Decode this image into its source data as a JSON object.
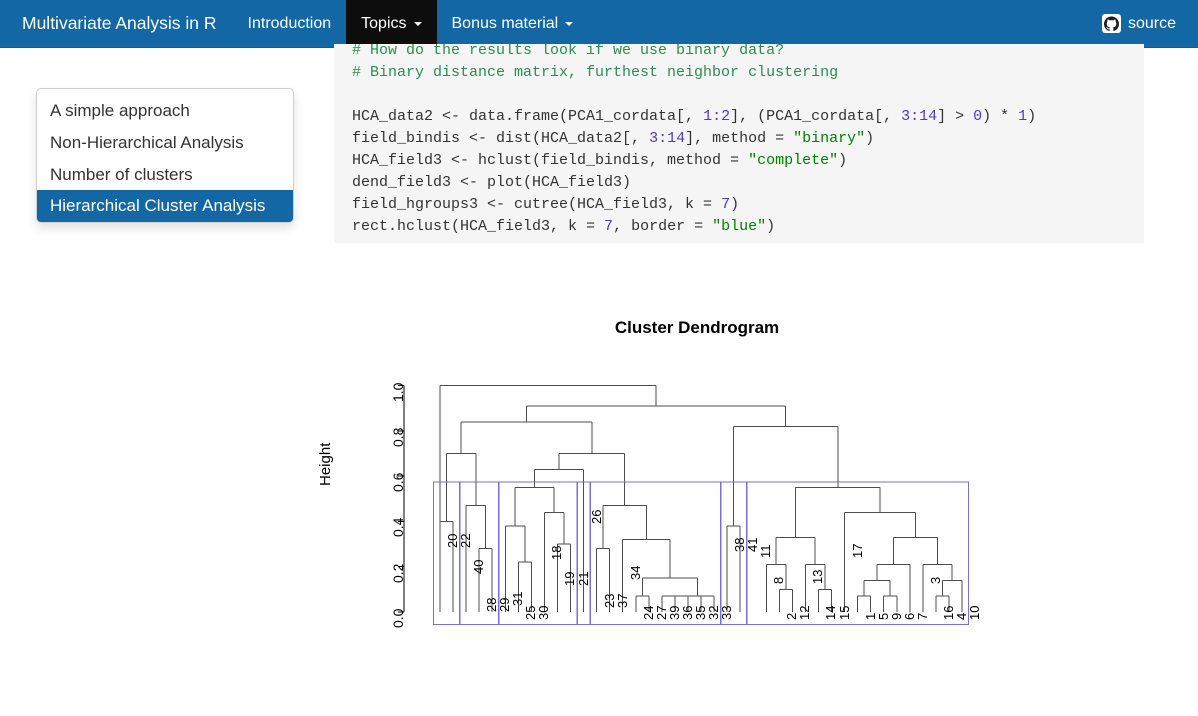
{
  "navbar": {
    "brand": "Multivariate Analysis in R",
    "items": [
      {
        "label": "Introduction",
        "active": false,
        "caret": false
      },
      {
        "label": "Topics",
        "active": true,
        "caret": true
      },
      {
        "label": "Bonus material",
        "active": false,
        "caret": true
      }
    ],
    "source_label": "source",
    "bg_color": "#1267a4",
    "active_bg_color": "#0d0d0d"
  },
  "sidebar": {
    "items": [
      {
        "label": "A simple approach",
        "selected": false
      },
      {
        "label": "Non-Hierarchical Analysis",
        "selected": false
      },
      {
        "label": "Number of clusters",
        "selected": false
      },
      {
        "label": "Hierarchical Cluster Analysis",
        "selected": true
      }
    ],
    "selected_bg_color": "#1267a4"
  },
  "code": {
    "lines": [
      [
        {
          "t": "# How do the results look if we use binary data?",
          "c": "com"
        }
      ],
      [
        {
          "t": "# Binary distance matrix, furthest neighbor clustering",
          "c": "com"
        }
      ],
      [
        {
          "t": "",
          "c": ""
        }
      ],
      [
        {
          "t": "HCA_data2 <- data.frame(PCA1_cordata[, ",
          "c": ""
        },
        {
          "t": "1:2",
          "c": "num"
        },
        {
          "t": "], (PCA1_cordata[, ",
          "c": ""
        },
        {
          "t": "3:14",
          "c": "num"
        },
        {
          "t": "] > ",
          "c": ""
        },
        {
          "t": "0",
          "c": "num"
        },
        {
          "t": ") * ",
          "c": ""
        },
        {
          "t": "1",
          "c": "num"
        },
        {
          "t": ")",
          "c": ""
        }
      ],
      [
        {
          "t": "field_bindis <- dist(HCA_data2[, ",
          "c": ""
        },
        {
          "t": "3:14",
          "c": "num"
        },
        {
          "t": "], method = ",
          "c": ""
        },
        {
          "t": "\"binary\"",
          "c": "str"
        },
        {
          "t": ")",
          "c": ""
        }
      ],
      [
        {
          "t": "HCA_field3 <- hclust(field_bindis, method = ",
          "c": ""
        },
        {
          "t": "\"complete\"",
          "c": "str"
        },
        {
          "t": ")",
          "c": ""
        }
      ],
      [
        {
          "t": "dend_field3 <- plot(HCA_field3)",
          "c": ""
        }
      ],
      [
        {
          "t": "field_hgroups3 <- cutree(HCA_field3, k = ",
          "c": ""
        },
        {
          "t": "7",
          "c": "num"
        },
        {
          "t": ")",
          "c": ""
        }
      ],
      [
        {
          "t": "rect.hclust(HCA_field3, k = ",
          "c": ""
        },
        {
          "t": "7",
          "c": "num"
        },
        {
          "t": ", border = ",
          "c": ""
        },
        {
          "t": "\"blue\"",
          "c": "str"
        },
        {
          "t": ")",
          "c": ""
        }
      ]
    ],
    "bg_color": "#f5f5f5"
  },
  "chart_data": {
    "type": "dendrogram",
    "title": "Cluster Dendrogram",
    "ylabel": "Height",
    "xlabel": "",
    "ylim": [
      0.0,
      1.06
    ],
    "yticks": [
      "0.0",
      "0.2",
      "0.4",
      "0.6",
      "0.8",
      "1.0"
    ],
    "ytick_values": [
      0.0,
      0.2,
      0.4,
      0.6,
      0.8,
      1.0
    ],
    "grid": false,
    "legend": "none",
    "cut_k": 7,
    "rect_border_color": "#7a6fd4",
    "link_color": "#4d4d4d",
    "leaf_labels": [
      "20",
      "22",
      "40",
      "28",
      "29",
      "31",
      "25",
      "30",
      "18",
      "19",
      "21",
      "26",
      "23",
      "37",
      "34",
      "24",
      "27",
      "39",
      "36",
      "35",
      "32",
      "33",
      "38",
      "41",
      "11",
      "8",
      "2",
      "12",
      "13",
      "14",
      "15",
      "17",
      "1",
      "5",
      "9",
      "6",
      "7",
      "3",
      "16",
      "4",
      "10"
    ],
    "clusters": [
      {
        "index": 1,
        "leaves": [
          "20",
          "22"
        ]
      },
      {
        "index": 2,
        "leaves": [
          "40",
          "28",
          "29"
        ]
      },
      {
        "index": 3,
        "leaves": [
          "31",
          "25",
          "30",
          "18",
          "19",
          "21"
        ]
      },
      {
        "index": 4,
        "leaves": [
          "26"
        ]
      },
      {
        "index": 5,
        "leaves": [
          "23",
          "37",
          "34",
          "24",
          "27",
          "39",
          "36",
          "35",
          "32",
          "33"
        ]
      },
      {
        "index": 6,
        "leaves": [
          "38",
          "41"
        ]
      },
      {
        "index": 7,
        "leaves": [
          "11",
          "8",
          "2",
          "12",
          "13",
          "14",
          "15",
          "17",
          "1",
          "5",
          "9",
          "6",
          "7",
          "3",
          "16",
          "4",
          "10"
        ]
      }
    ],
    "merges": [
      {
        "height": 1.0,
        "note": "root: leaf 20/22 branch vs rest"
      },
      {
        "height": 0.91,
        "note": "second split"
      },
      {
        "height": 0.84,
        "note": "left subtree split"
      },
      {
        "height": 0.82,
        "note": "right subtree split"
      },
      {
        "height": 0.7,
        "note": "left-left cluster join"
      },
      {
        "height": 0.63,
        "note": "cluster 26 / cluster 5 join"
      },
      {
        "height": 0.57,
        "note": "cut height (k = 7)"
      }
    ]
  }
}
